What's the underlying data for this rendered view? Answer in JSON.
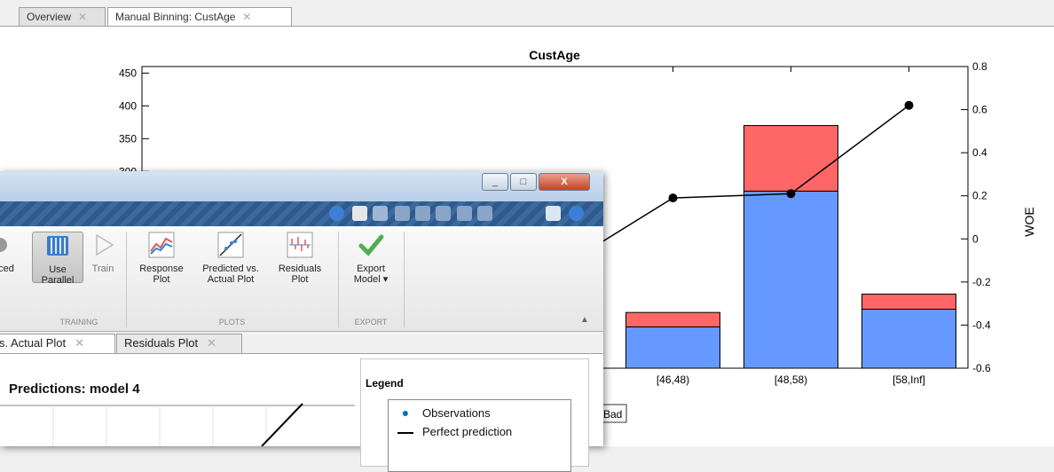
{
  "tabs": [
    {
      "label": "Overview",
      "close": "✕"
    },
    {
      "label": "Manual Binning: CustAge",
      "close": "✕"
    }
  ],
  "figure": {
    "partial_legend_text": "Bad"
  },
  "chart_data": {
    "type": "bar",
    "title": "CustAge",
    "ylabel_right": "WOE",
    "categories_visible": [
      "[46,48)",
      "[48,58)",
      "[58,Inf]"
    ],
    "left_axis": {
      "ylim": [
        0,
        460
      ],
      "ticks": [
        "450",
        "400",
        "350",
        "300"
      ]
    },
    "right_axis": {
      "ylim": [
        -0.6,
        0.8
      ],
      "ticks": [
        "0.8",
        "0.6",
        "0.4",
        "0.2",
        "0",
        "-0.2",
        "-0.4",
        "-0.6"
      ]
    },
    "series": [
      {
        "name": "Good",
        "color": "#6699ff",
        "values": [
          63,
          270,
          90
        ]
      },
      {
        "name": "Bad",
        "color": "#ff6666",
        "values": [
          22,
          100,
          23
        ]
      }
    ],
    "hidden_bar_top": 260,
    "woe_line": {
      "color": "#000000",
      "x": [
        "[46,48)",
        "[48,58)",
        "[58,Inf]"
      ],
      "values": [
        0.19,
        0.21,
        0.62
      ],
      "partial_start_value": -0.01
    },
    "grid": false
  },
  "window": {
    "title_buttons": [
      "_",
      "□",
      "X"
    ],
    "ribbon": {
      "buttons": [
        {
          "label": "ced"
        },
        {
          "label": "Use\nParallel"
        },
        {
          "label": "Train"
        },
        {
          "label": "Response\nPlot"
        },
        {
          "label": "Predicted vs.\nActual Plot"
        },
        {
          "label": "Residuals\nPlot"
        },
        {
          "label": "Export\nModel ▾"
        }
      ],
      "sections": [
        "TRAINING",
        "PLOTS",
        "EXPORT"
      ]
    },
    "doc_tabs": [
      {
        "label": "s. Actual Plot",
        "close": "✕"
      },
      {
        "label": "Residuals Plot",
        "close": "✕"
      }
    ],
    "plot_title": "Predictions: model 4",
    "legend": {
      "title": "Legend",
      "items": [
        "Observations",
        "Perfect prediction"
      ]
    }
  }
}
